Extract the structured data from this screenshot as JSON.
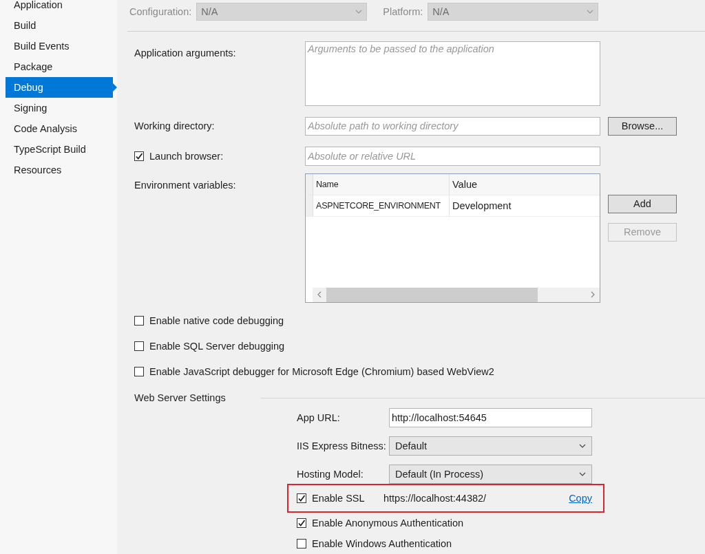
{
  "sidebar": {
    "items": [
      {
        "label": "Application",
        "selected": false
      },
      {
        "label": "Build",
        "selected": false
      },
      {
        "label": "Build Events",
        "selected": false
      },
      {
        "label": "Package",
        "selected": false
      },
      {
        "label": "Debug",
        "selected": true
      },
      {
        "label": "Signing",
        "selected": false
      },
      {
        "label": "Code Analysis",
        "selected": false
      },
      {
        "label": "TypeScript Build",
        "selected": false
      },
      {
        "label": "Resources",
        "selected": false
      }
    ]
  },
  "toolbar": {
    "configuration": {
      "label": "Configuration:",
      "value": "N/A",
      "disabled": true
    },
    "platform": {
      "label": "Platform:",
      "value": "N/A",
      "disabled": true
    }
  },
  "form": {
    "application_arguments": {
      "label": "Application arguments:",
      "placeholder": "Arguments to be passed to the application"
    },
    "working_directory": {
      "label": "Working directory:",
      "placeholder": "Absolute path to working directory",
      "button": "Browse..."
    },
    "launch_browser": {
      "label": "Launch browser:",
      "checked": true,
      "placeholder": "Absolute or relative URL"
    },
    "environment_variables": {
      "label": "Environment variables:",
      "columns": [
        "Name",
        "Value"
      ],
      "rows": [
        [
          "ASPNETCORE_ENVIRONMENT",
          "Development"
        ]
      ],
      "buttons": [
        {
          "label": "Add",
          "disabled": false
        },
        {
          "label": "Remove",
          "disabled": true
        }
      ]
    },
    "options": [
      {
        "label": "Enable native code debugging",
        "checked": false
      },
      {
        "label": "Enable SQL Server debugging",
        "checked": false
      },
      {
        "label": "Enable JavaScript debugger for Microsoft Edge (Chromium) based WebView2",
        "checked": false
      }
    ]
  },
  "web_server_settings": {
    "title": "Web Server Settings",
    "app_url": {
      "label": "App URL:",
      "value": "http://localhost:54645"
    },
    "iis_express_bitness": {
      "label": "IIS Express Bitness:",
      "value": "Default"
    },
    "hosting_model": {
      "label": "Hosting Model:",
      "value": "Default (In Process)"
    },
    "ssl": {
      "label": "Enable SSL",
      "checked": true,
      "url": "https://localhost:44382/",
      "link": "Copy",
      "highlighted": true
    },
    "auth": [
      {
        "label": "Enable Anonymous Authentication",
        "checked": true
      },
      {
        "label": "Enable Windows Authentication",
        "checked": false
      }
    ]
  }
}
